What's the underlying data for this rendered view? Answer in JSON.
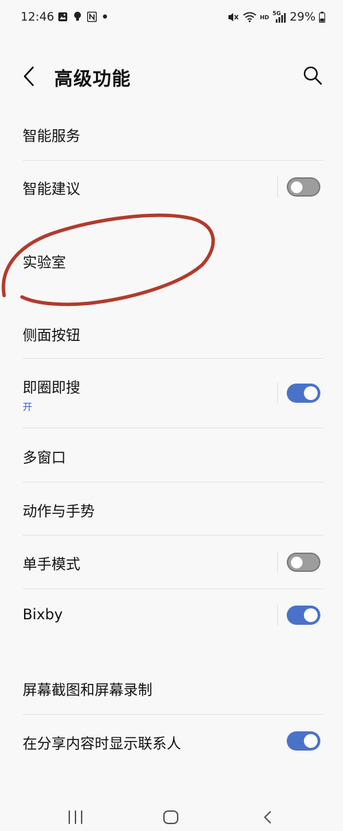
{
  "status_bar": {
    "time": "12:46",
    "battery": "29%",
    "network_hd": "HD",
    "network_5g": "5G"
  },
  "header": {
    "title": "高级功能",
    "back_icon": "chevron-left-icon",
    "search_icon": "search-icon"
  },
  "rows": [
    {
      "label": "智能服务"
    },
    {
      "label": "智能建议",
      "toggle": "off"
    },
    {
      "label": "实验室"
    },
    {
      "label": "侧面按钮"
    },
    {
      "label": "即圈即搜",
      "subtitle": "开",
      "toggle": "on"
    },
    {
      "label": "多窗口"
    },
    {
      "label": "动作与手势"
    },
    {
      "label": "单手模式",
      "toggle": "off"
    },
    {
      "label": "Bixby",
      "toggle": "on"
    },
    {
      "label": "屏幕截图和屏幕录制"
    },
    {
      "label": "在分享内容时显示联系人",
      "toggle": "on"
    }
  ],
  "colors": {
    "background": "#f8f8f8",
    "toggle_on": "#4a72c9",
    "toggle_off": "#9d9d9d",
    "subtitle": "#3f64c5",
    "annotation": "#b33a2c"
  },
  "nav_bar": {
    "recents_icon": "recents-icon",
    "home_icon": "home-icon",
    "back_icon": "back-icon"
  }
}
